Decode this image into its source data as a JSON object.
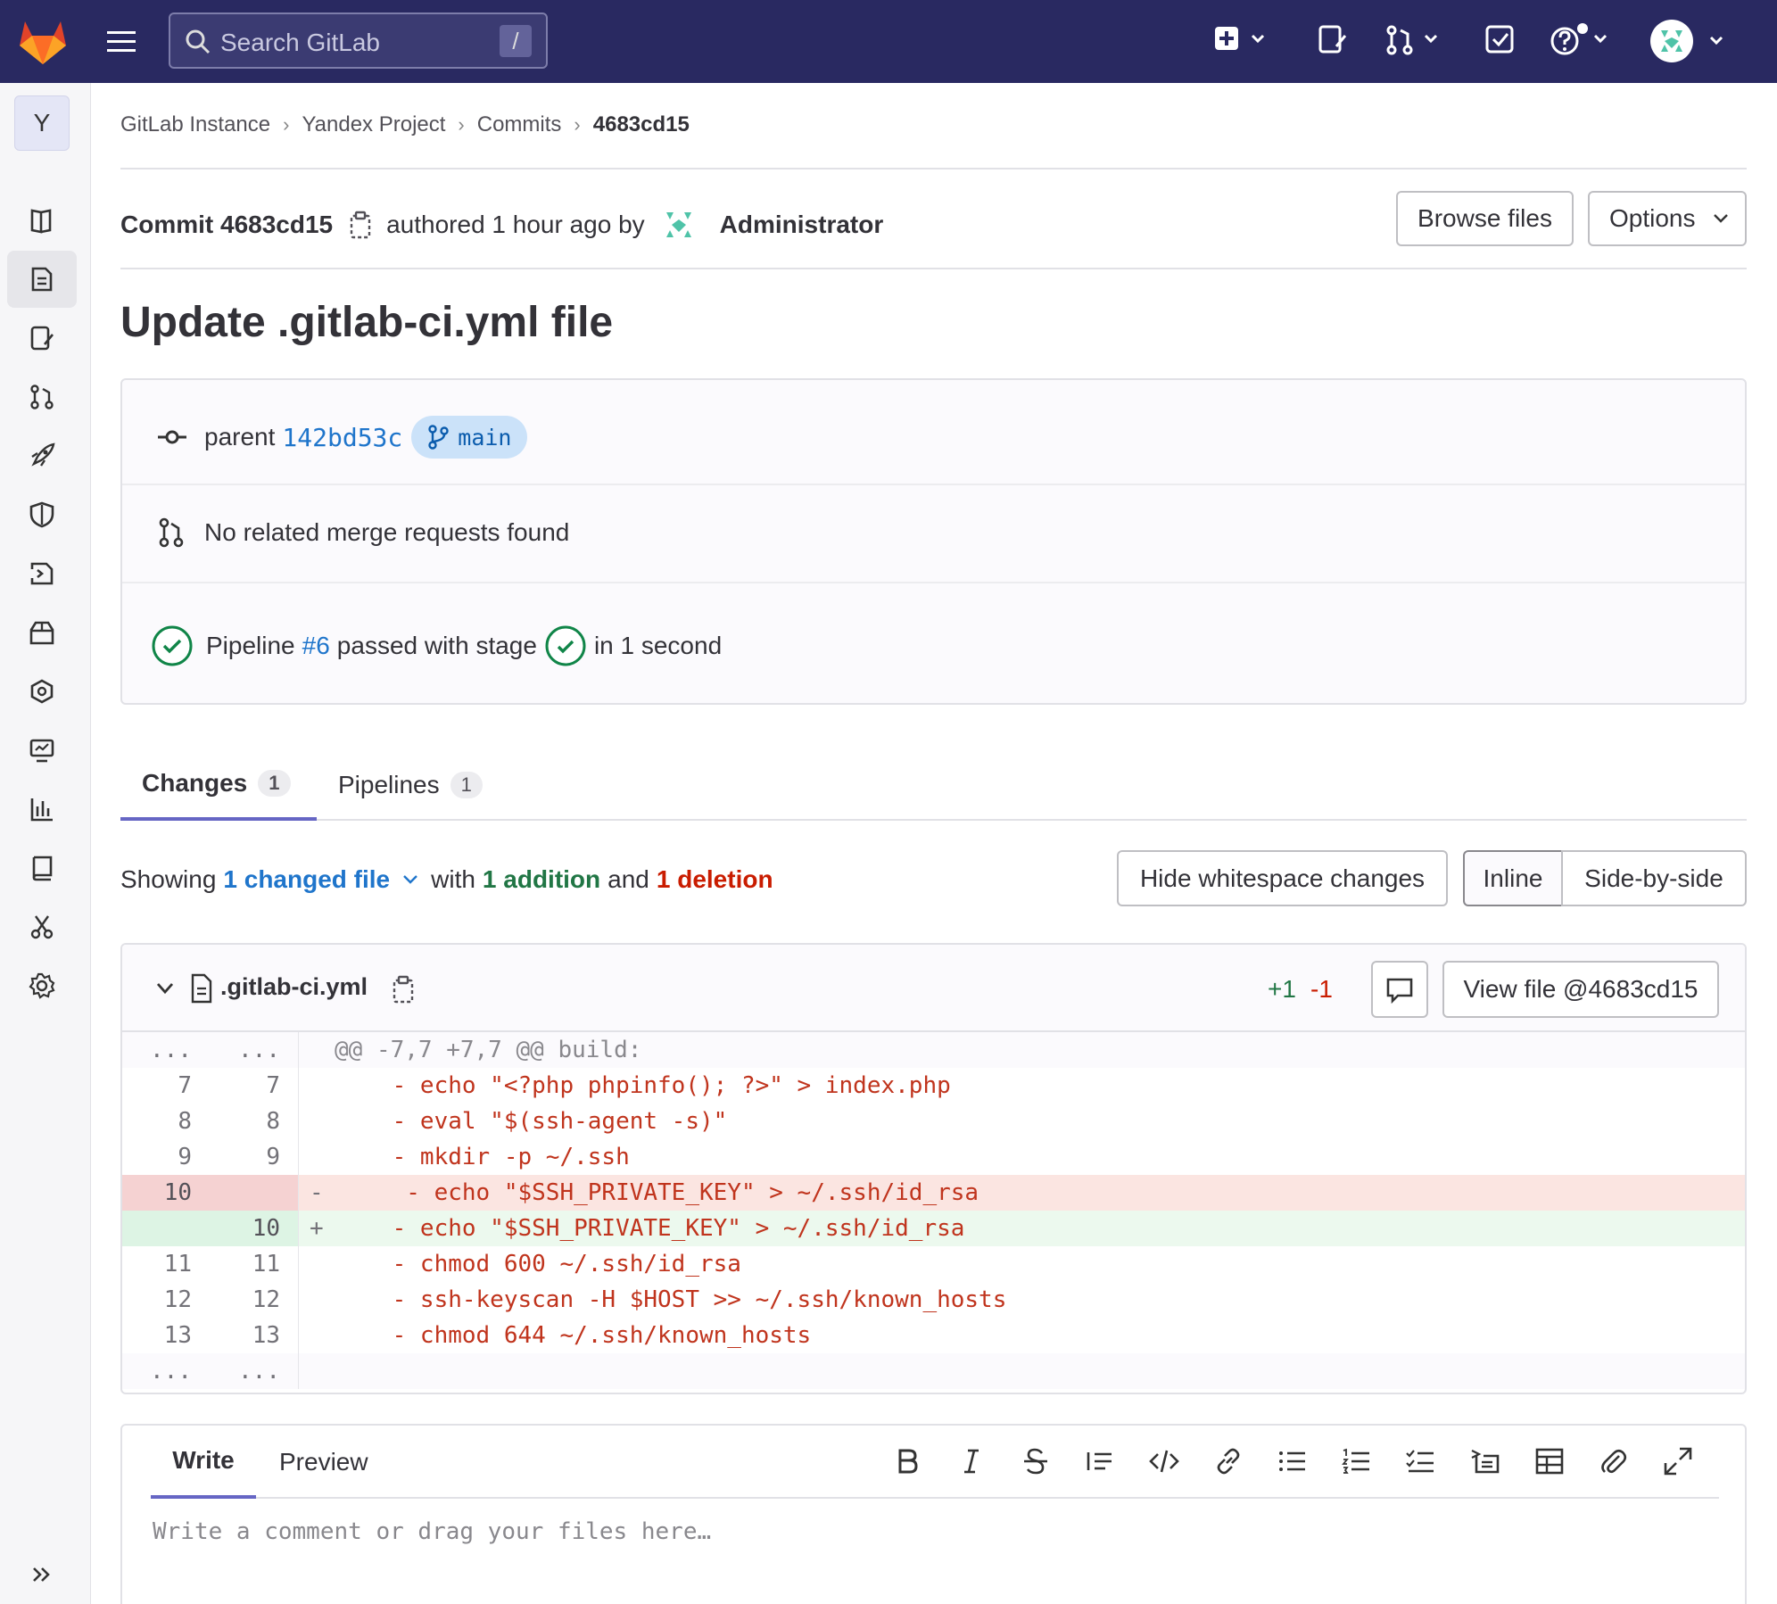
{
  "topbar": {
    "search_placeholder": "Search GitLab",
    "search_shortcut": "/"
  },
  "sidebar": {
    "project_letter": "Y",
    "items": [
      "project-overview",
      "repository",
      "issues",
      "merge-requests",
      "deployments",
      "security",
      "ci-cd",
      "packages",
      "infrastructure",
      "monitor",
      "analytics",
      "wiki",
      "snippets",
      "settings"
    ]
  },
  "breadcrumb": [
    "GitLab Instance",
    "Yandex Project",
    "Commits",
    "4683cd15"
  ],
  "commit": {
    "label": "Commit 4683cd15",
    "authored": "authored 1 hour ago by",
    "author": "Administrator",
    "browse_files": "Browse files",
    "options": "Options"
  },
  "title": "Update .gitlab-ci.yml file",
  "info": {
    "parent_label": "parent",
    "parent_sha": "142bd53c",
    "branch": "main",
    "mr_text": "No related merge requests found",
    "pipeline_prefix": "Pipeline",
    "pipeline_id": "#6",
    "pipeline_mid": "passed with stage",
    "pipeline_suffix": "in 1 second"
  },
  "tabs": [
    {
      "label": "Changes",
      "count": "1"
    },
    {
      "label": "Pipelines",
      "count": "1"
    }
  ],
  "summary": {
    "showing": "Showing",
    "changed": "1 changed file",
    "with": "with",
    "additions": "1 addition",
    "and": "and",
    "deletions": "1 deletion",
    "hide_ws": "Hide whitespace changes",
    "inline": "Inline",
    "side": "Side-by-side"
  },
  "file": {
    "name": ".gitlab-ci.yml",
    "plus": "+1",
    "minus": "-1",
    "view": "View file @4683cd15"
  },
  "diff": [
    {
      "type": "hunk",
      "old": "...",
      "new": "...",
      "sign": "",
      "code": "@@ -7,7 +7,7 @@ build:"
    },
    {
      "type": "ctx",
      "old": "7",
      "new": "7",
      "sign": "",
      "code": "    - echo \"<?php phpinfo(); ?>\" > index.php"
    },
    {
      "type": "ctx",
      "old": "8",
      "new": "8",
      "sign": "",
      "code": "    - eval \"$(ssh-agent -s)\""
    },
    {
      "type": "ctx",
      "old": "9",
      "new": "9",
      "sign": "",
      "code": "    - mkdir -p ~/.ssh"
    },
    {
      "type": "del",
      "old": "10",
      "new": "",
      "sign": "-",
      "code": "     - echo \"$SSH_PRIVATE_KEY\" > ~/.ssh/id_rsa"
    },
    {
      "type": "add",
      "old": "",
      "new": "10",
      "sign": "+",
      "code": "    - echo \"$SSH_PRIVATE_KEY\" > ~/.ssh/id_rsa"
    },
    {
      "type": "ctx",
      "old": "11",
      "new": "11",
      "sign": "",
      "code": "    - chmod 600 ~/.ssh/id_rsa"
    },
    {
      "type": "ctx",
      "old": "12",
      "new": "12",
      "sign": "",
      "code": "    - ssh-keyscan -H $HOST >> ~/.ssh/known_hosts"
    },
    {
      "type": "ctx",
      "old": "13",
      "new": "13",
      "sign": "",
      "code": "    - chmod 644 ~/.ssh/known_hosts"
    },
    {
      "type": "hunk",
      "old": "...",
      "new": "...",
      "sign": "",
      "code": ""
    }
  ],
  "editor": {
    "write": "Write",
    "preview": "Preview",
    "placeholder": "Write a comment or drag your files here…",
    "tools": [
      "bold-icon",
      "italic-icon",
      "strikethrough-icon",
      "quote-icon",
      "code-icon",
      "link-icon",
      "bullet-list-icon",
      "numbered-list-icon",
      "task-list-icon",
      "collapsible-icon",
      "table-icon",
      "attach-icon",
      "fullscreen-icon"
    ]
  },
  "colors": {
    "topbar": "#292961",
    "link": "#1f75cb",
    "success": "#108548",
    "danger": "#c91c00"
  }
}
